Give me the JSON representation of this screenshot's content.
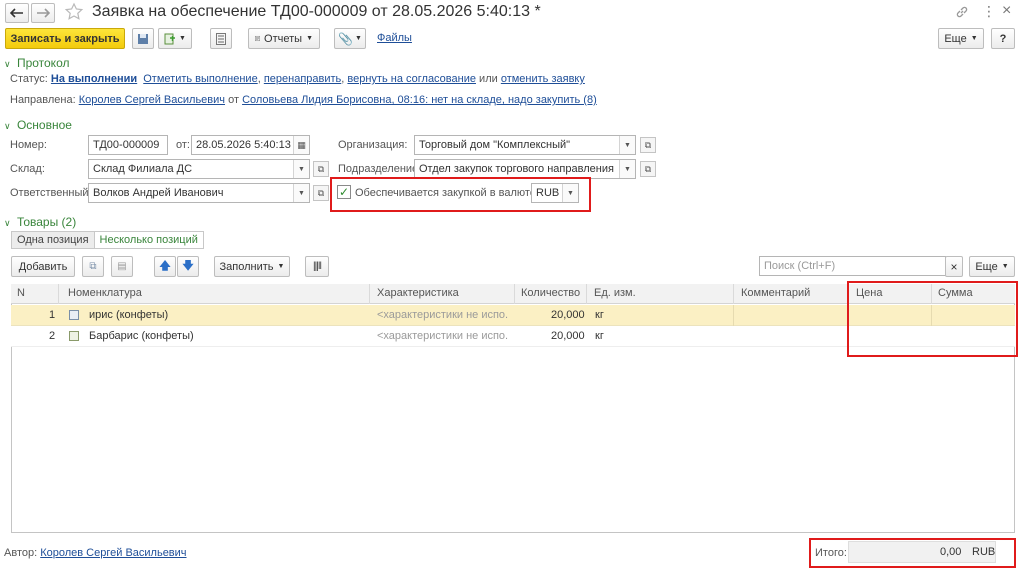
{
  "window": {
    "title": "Заявка на обеспечение ТД00-000009 от 28.05.2026 5:40:13 *"
  },
  "toolbar": {
    "save_close": "Записать и закрыть",
    "reports": "Отчеты",
    "files": "Файлы",
    "more": "Еще",
    "help": "?"
  },
  "protocol": {
    "header": "Протокол",
    "status_label": "Статус:",
    "status_value": "На выполнении",
    "action_mark": "Отметить выполнение",
    "action_redirect": "перенаправить",
    "action_return": "вернуть на согласование",
    "or_text": "или",
    "action_cancel": "отменить заявку",
    "sent_label": "Направлена:",
    "sent_from": "Королев Сергей Васильевич",
    "from_text": "от",
    "sent_reply": "Соловьева Лидия Борисовна, 08:16: нет на складе, надо закупить (8)"
  },
  "main": {
    "header": "Основное",
    "number_label": "Номер:",
    "number_value": "ТД00-000009",
    "date_label": "от:",
    "date_value": "28.05.2026  5:40:13",
    "org_label": "Организация:",
    "org_value": "Торговый дом \"Комплексный\"",
    "warehouse_label": "Склад:",
    "warehouse_value": "Склад Филиала ДС",
    "dept_label": "Подразделение:",
    "dept_value": "Отдел закупок торгового направления",
    "responsible_label": "Ответственный:",
    "responsible_value": "Волков Андрей Иванович",
    "currency_check_label": "Обеспечивается закупкой в валюте:",
    "currency_value": "RUB"
  },
  "goods": {
    "header": "Товары (2)",
    "tab_one": "Одна позиция",
    "tab_many": "Несколько позиций",
    "add": "Добавить",
    "fill": "Заполнить",
    "search_placeholder": "Поиск (Ctrl+F)",
    "clear": "×",
    "more": "Еще",
    "columns": {
      "n": "N",
      "item": "Номенклатура",
      "characteristic": "Характеристика",
      "quantity": "Количество",
      "unit": "Ед. изм.",
      "comment": "Комментарий",
      "price": "Цена",
      "sum": "Сумма"
    },
    "rows": [
      {
        "n": "1",
        "item": "ирис (конфеты)",
        "characteristic": "<характеристики не испо...",
        "quantity": "20,000",
        "unit": "кг",
        "comment": "",
        "price": "",
        "sum": ""
      },
      {
        "n": "2",
        "item": "Барбарис (конфеты)",
        "characteristic": "<характеристики не испо...",
        "quantity": "20,000",
        "unit": "кг",
        "comment": "",
        "price": "",
        "sum": ""
      }
    ]
  },
  "footer": {
    "author_label": "Автор:",
    "author_value": "Королев Сергей Васильевич",
    "total_label": "Итого:",
    "total_value": "0,00",
    "total_currency": "RUB"
  },
  "colors": {
    "accent_yellow": "#f5d20f",
    "link_blue": "#1e4e98",
    "section_green": "#39853b",
    "highlight_red": "#e01b1b",
    "row_selected": "#fbf0c4"
  }
}
